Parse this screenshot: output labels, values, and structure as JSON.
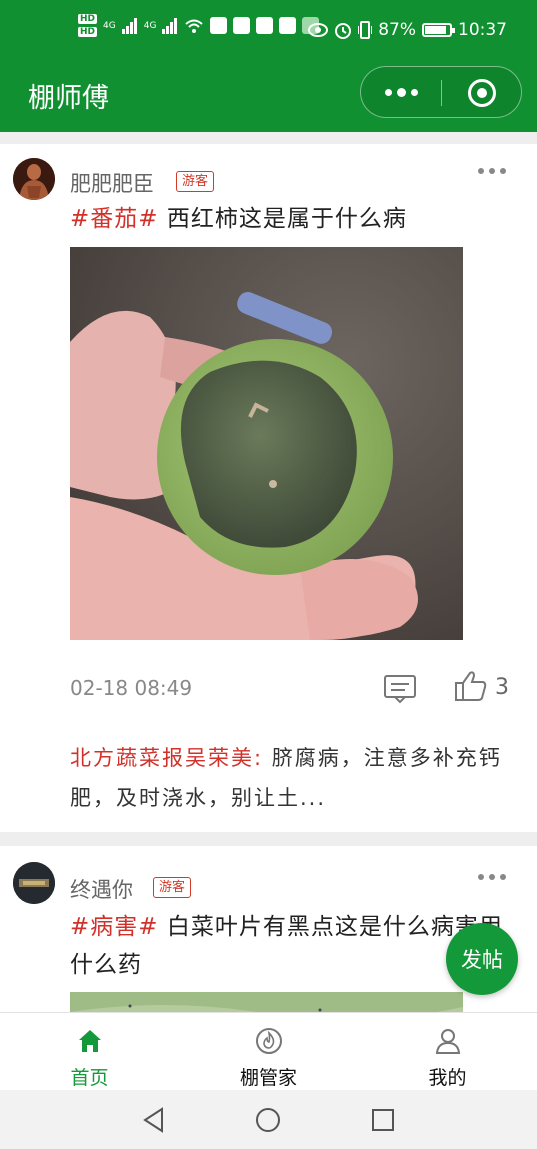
{
  "status_bar": {
    "hd1": "HD",
    "hd2": "HD",
    "signal1": "4G",
    "signal2": "4G",
    "battery_percent": "87%",
    "battery_level": 0.87,
    "time": "10:37"
  },
  "nav": {
    "title": "棚师傅"
  },
  "posts": [
    {
      "username": "肥肥肥臣",
      "badge": "游客",
      "topic": "#番茄#",
      "text": " 西红柿这是属于什么病",
      "time": "02-18 08:49",
      "likes": "3",
      "reply_author": "北方蔬菜报吴荣美:",
      "reply_text": " 脐腐病，注意多补充钙肥，及时浇水，别让土..."
    },
    {
      "username": "终遇你",
      "badge": "游客",
      "topic": "#病害#",
      "text": " 白菜叶片有黑点这是什么病害用什么药"
    }
  ],
  "fab": {
    "label": "发帖"
  },
  "tabbar": {
    "tabs": [
      {
        "label": "首页",
        "icon": "home-icon",
        "active": true
      },
      {
        "label": "棚管家",
        "icon": "fire-icon",
        "active": false
      },
      {
        "label": "我的",
        "icon": "user-icon",
        "active": false
      }
    ]
  },
  "colors": {
    "brand_green": "#109030",
    "topic_red": "#d2312a",
    "fab_green": "#14993a"
  }
}
